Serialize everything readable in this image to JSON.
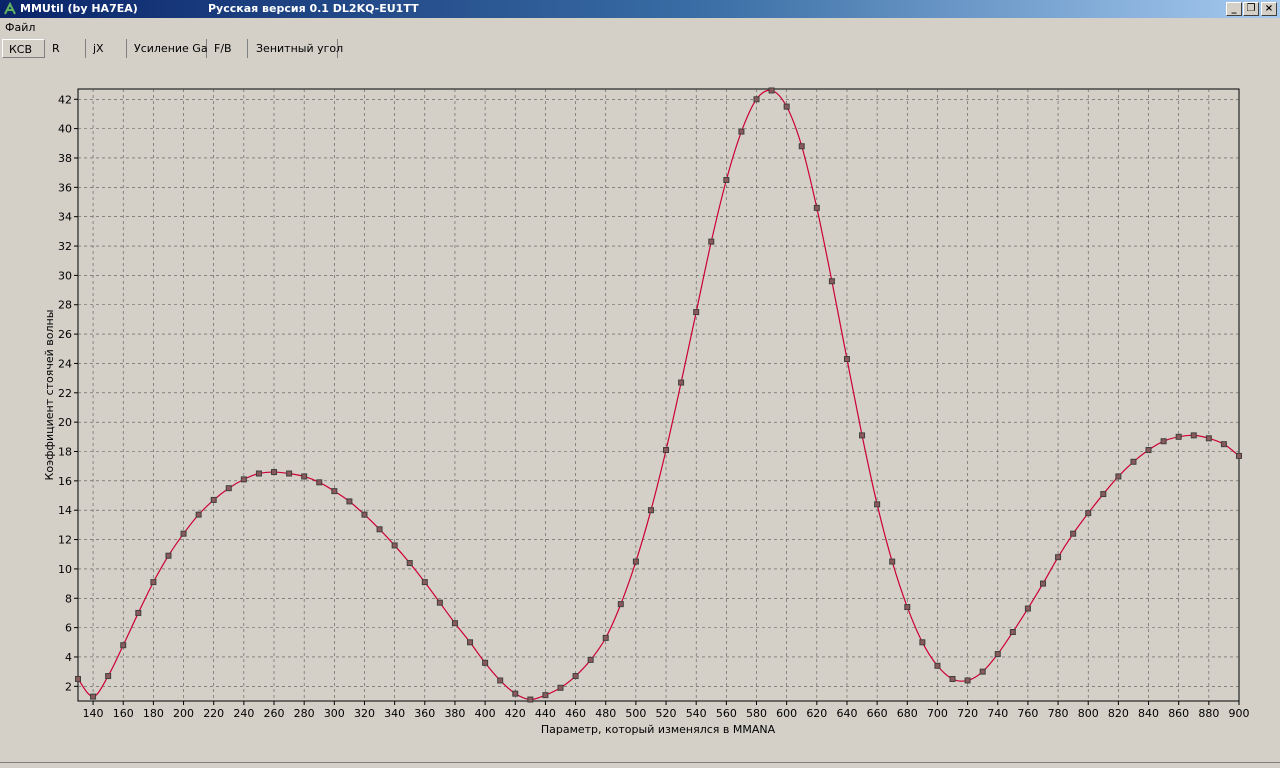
{
  "window": {
    "title": "MMUtil (by HA7EA)",
    "subtitle": "Русская версия 0.1 DL2KQ-EU1TT",
    "controls": {
      "minimize": "_",
      "restore": "❐",
      "close": "×"
    }
  },
  "menu": {
    "file": "Файл"
  },
  "tabs": [
    {
      "label": "КСВ",
      "active": true
    },
    {
      "label": "R",
      "active": false
    },
    {
      "label": "jX",
      "active": false
    },
    {
      "label": "Усиление Ga",
      "active": false
    },
    {
      "label": "F/B",
      "active": false
    },
    {
      "label": "Зенитный угол",
      "active": false
    }
  ],
  "colors": {
    "line": "#cc0033",
    "marker": "#404040",
    "grid": "#555555",
    "title_gradient_start": "#0a246a"
  },
  "chart_data": {
    "type": "line",
    "xlabel": "Параметр, который изменялся в MMANA",
    "ylabel": "Коэффициент стоячей волны",
    "xlim": [
      130,
      900
    ],
    "ylim": [
      1,
      42.7
    ],
    "x_ticks": [
      140,
      160,
      180,
      200,
      220,
      240,
      260,
      280,
      300,
      320,
      340,
      360,
      380,
      400,
      420,
      440,
      460,
      480,
      500,
      520,
      540,
      560,
      580,
      600,
      620,
      640,
      660,
      680,
      700,
      720,
      740,
      760,
      780,
      800,
      820,
      840,
      860,
      880,
      900
    ],
    "y_ticks": [
      2,
      4,
      6,
      8,
      10,
      12,
      14,
      16,
      18,
      20,
      22,
      24,
      26,
      28,
      30,
      32,
      34,
      36,
      38,
      40,
      42
    ],
    "grid": true,
    "series": [
      {
        "x": [
          130,
          140,
          150,
          160,
          170,
          180,
          190,
          200,
          210,
          220,
          230,
          240,
          250,
          260,
          270,
          280,
          290,
          300,
          310,
          320,
          330,
          340,
          350,
          360,
          370,
          380,
          390,
          400,
          410,
          420,
          430,
          440,
          450,
          460,
          470,
          480,
          490,
          500,
          510,
          520,
          530,
          540,
          550,
          560,
          570,
          580,
          590,
          600,
          610,
          620,
          630,
          640,
          650,
          660,
          670,
          680,
          690,
          700,
          710,
          720,
          730,
          740,
          750,
          760,
          770,
          780,
          790,
          800,
          810,
          820,
          830,
          840,
          850,
          860,
          870,
          880,
          890,
          900
        ],
        "y": [
          2.5,
          1.3,
          2.7,
          4.8,
          7.0,
          9.1,
          10.9,
          12.4,
          13.7,
          14.7,
          15.5,
          16.1,
          16.5,
          16.6,
          16.5,
          16.3,
          15.9,
          15.3,
          14.6,
          13.7,
          12.7,
          11.6,
          10.4,
          9.1,
          7.7,
          6.3,
          5.0,
          3.6,
          2.4,
          1.5,
          1.1,
          1.4,
          1.9,
          2.7,
          3.8,
          5.3,
          7.6,
          10.5,
          14.0,
          18.1,
          22.7,
          27.5,
          32.3,
          36.5,
          39.8,
          42.0,
          42.6,
          41.5,
          38.8,
          34.6,
          29.6,
          24.3,
          19.1,
          14.4,
          10.5,
          7.4,
          5.0,
          3.4,
          2.5,
          2.4,
          3.0,
          4.2,
          5.7,
          7.3,
          9.0,
          10.8,
          12.4,
          13.8,
          15.1,
          16.3,
          17.3,
          18.1,
          18.7,
          19.0,
          19.1,
          18.9,
          18.5,
          17.7
        ]
      }
    ]
  }
}
